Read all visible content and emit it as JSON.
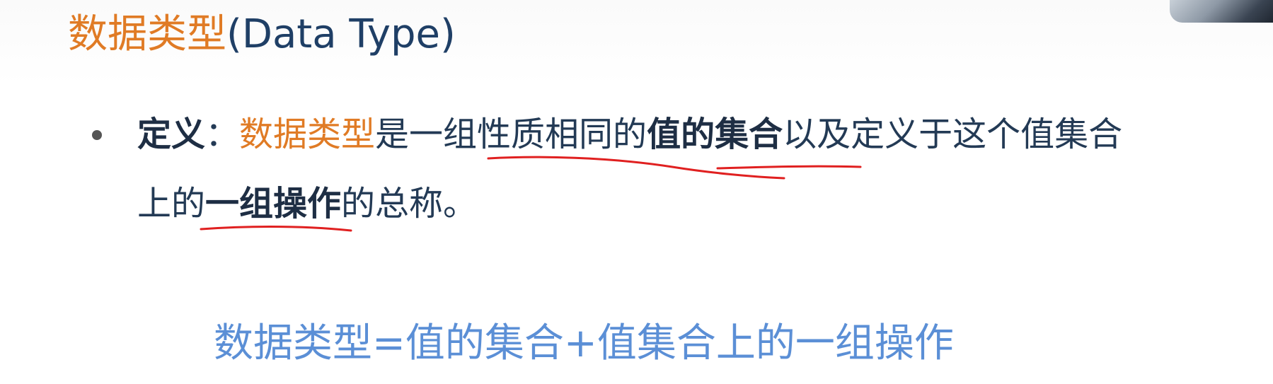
{
  "title": {
    "cn": "数据类型",
    "en": "(Data Type)"
  },
  "bullet": {
    "label": "定义",
    "colon": "：",
    "term": "数据类型",
    "line1_a": "是一组性质相同的",
    "line1_b": "值的集合",
    "line1_c": "以及定义于这个值集合",
    "line2_a": "上的",
    "line2_b": "一组操作",
    "line2_c": "的总称。"
  },
  "formula": "数据类型=值的集合+值集合上的一组操作",
  "colors": {
    "title_orange": "#e07b25",
    "text_dark": "#1e2e44",
    "formula_blue": "#5b8fd6",
    "annotation_red": "#e02020"
  }
}
